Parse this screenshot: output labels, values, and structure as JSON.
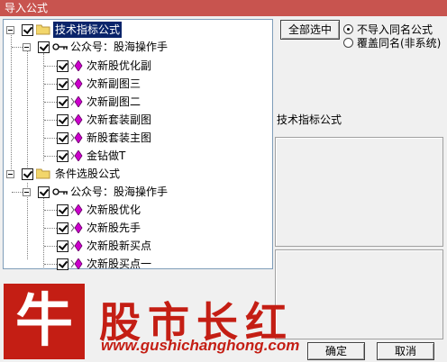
{
  "window": {
    "title": "导入公式"
  },
  "tree": {
    "groups": [
      {
        "label": "技术指标公式",
        "checked": true,
        "selected": true,
        "child": {
          "label": "公众号：股海操作手",
          "checked": true,
          "items": [
            "次新股优化副",
            "次新副图三",
            "次新副图二",
            "次新套装副图",
            "新股套装主图",
            "金钻做T"
          ]
        }
      },
      {
        "label": "条件选股公式",
        "checked": true,
        "selected": false,
        "child": {
          "label": "公众号：股海操作手",
          "checked": true,
          "items": [
            "次新股优化",
            "次新股先手",
            "次新股新买点",
            "次新股买点一"
          ]
        }
      }
    ]
  },
  "buttons": {
    "select_all": "全部选中",
    "ok": "确定",
    "cancel": "取消"
  },
  "radios": [
    {
      "label": "不导入同名公式",
      "selected": true
    },
    {
      "label": "覆盖同名(非系统)",
      "selected": false
    }
  ],
  "info": {
    "type_label": "技术指标公式"
  },
  "watermark": {
    "logo_char": "牛",
    "brand": "股市长红",
    "url": "www.gushichanghong.com"
  },
  "colors": {
    "title_bar": "#c8544f",
    "brand_red": "#c41e14",
    "selection": "#0a246a",
    "formula_icon": "#cc00cc"
  }
}
